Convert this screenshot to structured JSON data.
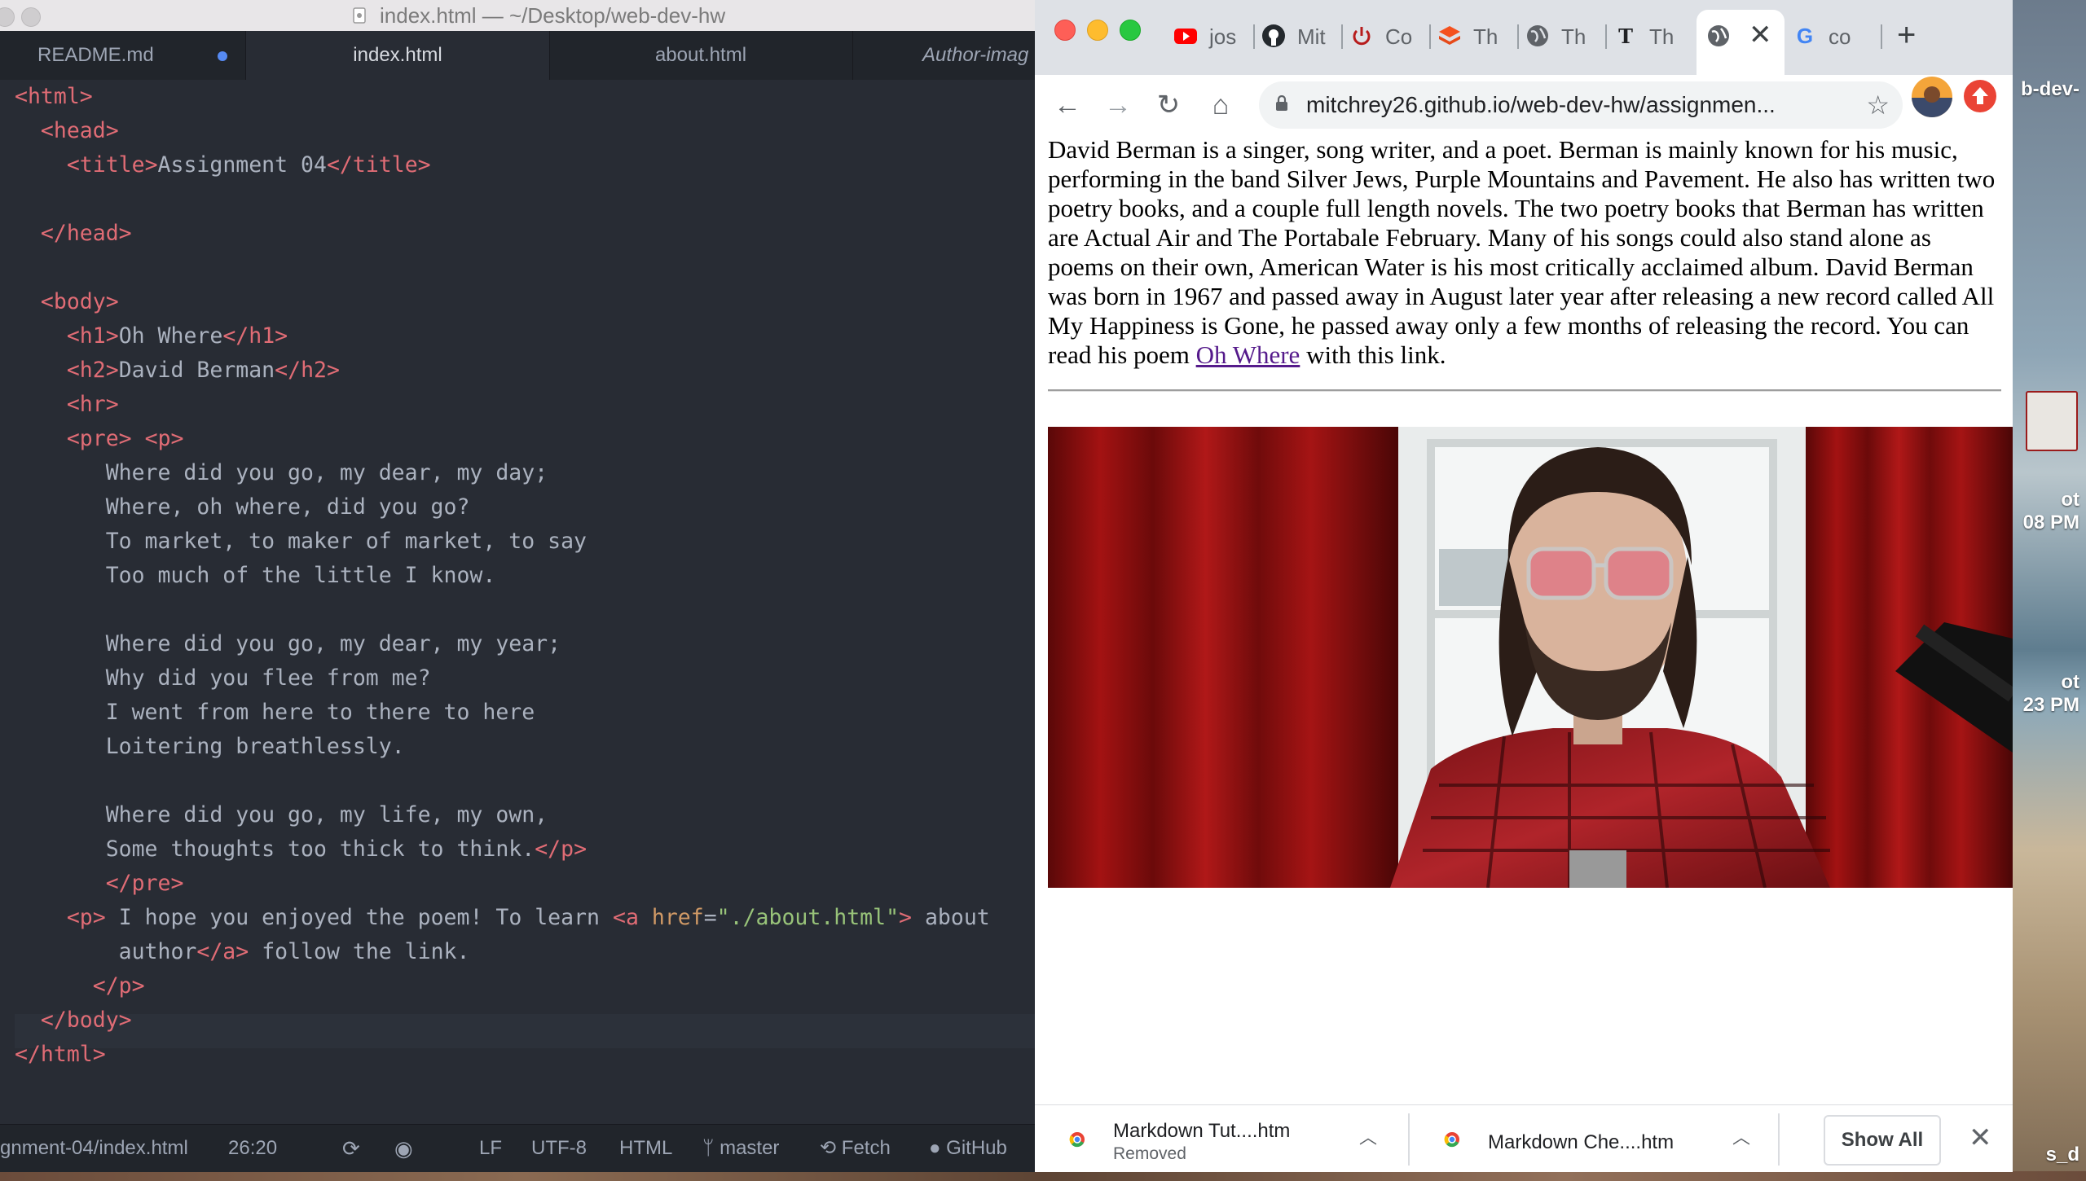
{
  "editor": {
    "window_title": "index.html — ~/Desktop/web-dev-hw",
    "tabs": [
      {
        "label": "README.md",
        "modified": true
      },
      {
        "label": "index.html",
        "active": true
      },
      {
        "label": "about.html"
      },
      {
        "label": "Author-imag"
      }
    ],
    "code": {
      "l1": "html",
      "l2": "head",
      "l3_tag": "title",
      "l3_text": "Assignment 04",
      "l5": "head",
      "l7": "body",
      "h1_tag": "h1",
      "h1_text": "Oh Where",
      "h2_tag": "h2",
      "h2_text": "David Berman",
      "hr_tag": "hr",
      "pre_tag": "pre",
      "p_tag": "p",
      "poem": [
        "Where did you go, my dear, my day;",
        "Where, oh where, did you go?",
        "To market, to maker of market, to say",
        "Too much of the little I know.",
        "Where did you go, my dear, my year;",
        "Why did you flee from me?",
        "I went from here to there to here",
        "Loitering breathlessly.",
        "Where did you go, my life, my own,",
        "Some thoughts too thick to think."
      ],
      "p2_text": " I hope you enjoyed the poem! To learn ",
      "a_tag": "a",
      "href_attr": "href",
      "href_val": "\"./about.html\"",
      "p2_link_start": " about",
      "p2_link_cont": "author",
      "p2_tail": " follow the link."
    },
    "status": {
      "path": "gnment-04/index.html",
      "cursor": "26:20",
      "line_ending": "LF",
      "encoding": "UTF-8",
      "grammar": "HTML",
      "branch": "master",
      "fetch": "Fetch",
      "github": "GitHub"
    }
  },
  "browser": {
    "tabs": [
      {
        "label": "jos",
        "icon": "youtube-icon",
        "color": "#ff0000"
      },
      {
        "label": "Mit",
        "icon": "github-icon",
        "color": "#24292e"
      },
      {
        "label": "Co",
        "icon": "power-icon",
        "color": "#b71c1c"
      },
      {
        "label": "Th",
        "icon": "stack-icon",
        "color": "#f4511e"
      },
      {
        "label": "Th",
        "icon": "globe-icon",
        "color": "#5f6368"
      },
      {
        "label": "Th",
        "icon": "nyt-icon",
        "color": "#202124"
      },
      {
        "label": "",
        "icon": "globe-icon",
        "active": true
      },
      {
        "label": "co",
        "icon": "google-icon",
        "color": "#4285f4"
      }
    ],
    "url": "mitchrey26.github.io/web-dev-hw/assignmen...",
    "page": {
      "paragraph_text": "David Berman is a singer, song writer, and a poet. Berman is mainly known for his music, performing in the band Silver Jews, Purple Mountains and Pavement. He also has written two poetry books, and a couple full length novels. The two poetry books that Berman has written are Actual Air and The Portabale February. Many of his songs could also stand alone as poems on their own, American Water is his most critically acclaimed album. David Berman was born in 1967 and passed away in August later year after releasing a new record called All My Happiness is Gone, he passed away only a few months of releasing the record. You can read his poem ",
      "link_text": "Oh Where",
      "paragraph_tail": " with this link."
    },
    "downloads": [
      {
        "name": "Markdown Tut....htm",
        "status": "Removed"
      },
      {
        "name": "Markdown Che....htm",
        "status": ""
      }
    ],
    "show_all": "Show All"
  },
  "desktop": {
    "label1_a": "b-dev-",
    "label2_a": "ot",
    "label2_b": "08 PM",
    "label3_a": "ot",
    "label3_b": "23 PM",
    "label4_a": "s_d"
  },
  "colors": {
    "editor_bg": "#282c34",
    "tag_red": "#e06c75",
    "attr_orange": "#d19a66",
    "string_green": "#98c379",
    "link_visited": "#551a8b"
  }
}
